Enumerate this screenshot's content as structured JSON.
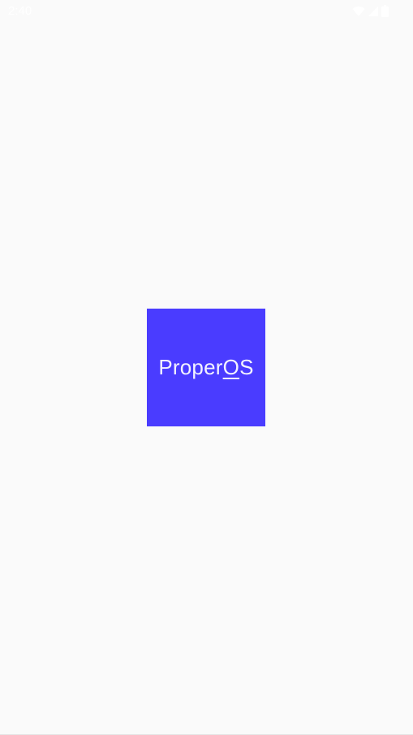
{
  "status_bar": {
    "time": "2:40",
    "icons": [
      "wifi-icon",
      "cell-signal-icon",
      "battery-icon"
    ]
  },
  "splash": {
    "logo": {
      "text_prefix": "Proper",
      "text_underlined": "O",
      "text_suffix": "S",
      "background_color": "#4a3cff",
      "text_color": "#f2f2ff"
    }
  },
  "colors": {
    "page_background": "#fafafa"
  }
}
